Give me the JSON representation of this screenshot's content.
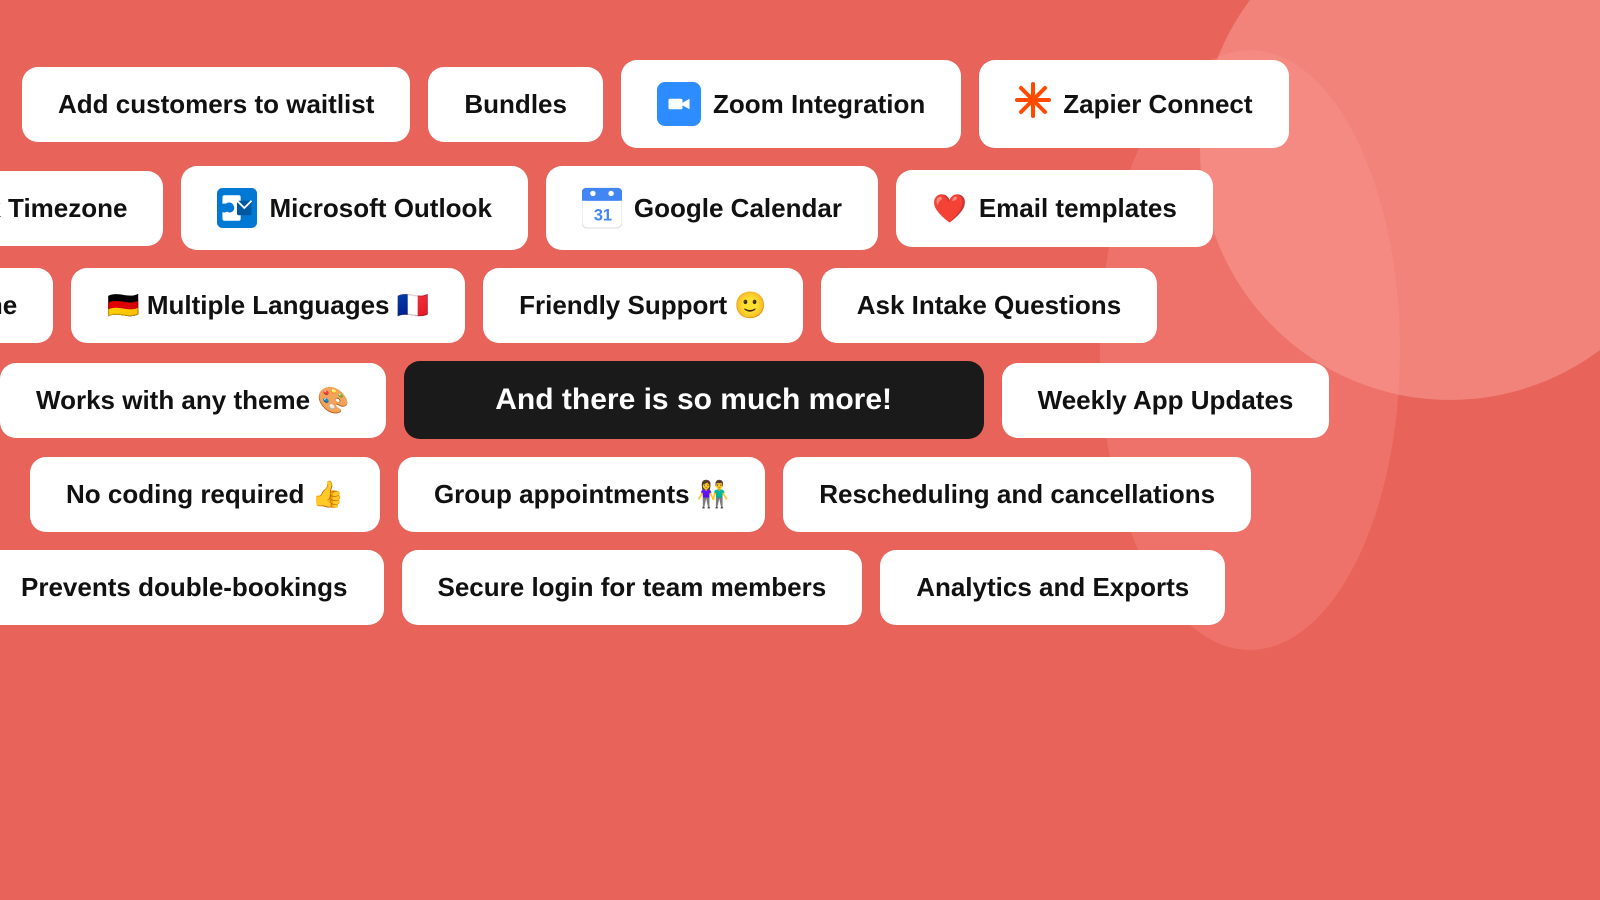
{
  "background": "#e8635a",
  "rows": [
    {
      "id": "row1",
      "items": [
        {
          "id": "add-waitlist",
          "text": "Add customers to waitlist",
          "type": "plain"
        },
        {
          "id": "bundles",
          "text": "Bundles",
          "type": "plain"
        },
        {
          "id": "zoom",
          "text": "Zoom Integration",
          "type": "zoom"
        },
        {
          "id": "zapier",
          "text": "Zapier Connect",
          "type": "zapier"
        }
      ]
    },
    {
      "id": "row2",
      "items": [
        {
          "id": "timezone",
          "text": "ock Timezone",
          "type": "plain"
        },
        {
          "id": "outlook",
          "text": "Microsoft Outlook",
          "type": "outlook"
        },
        {
          "id": "gcal",
          "text": "Google Calendar",
          "type": "gcal"
        },
        {
          "id": "email-templates",
          "text": "Email templates",
          "type": "email"
        }
      ]
    },
    {
      "id": "row3",
      "items": [
        {
          "id": "uptime",
          "text": "o Uptime",
          "type": "plain"
        },
        {
          "id": "languages",
          "text": "🇩🇪 Multiple Languages 🇫🇷",
          "type": "plain"
        },
        {
          "id": "support",
          "text": "Friendly Support 🙂",
          "type": "plain"
        },
        {
          "id": "intake",
          "text": "Ask Intake Questions",
          "type": "plain"
        }
      ]
    },
    {
      "id": "row4",
      "items": [
        {
          "id": "theme",
          "text": "Works with any theme 🎨",
          "type": "plain"
        },
        {
          "id": "more",
          "text": "And there is so much more!",
          "type": "dark"
        },
        {
          "id": "weekly-updates",
          "text": "Weekly App Updates",
          "type": "plain"
        }
      ]
    },
    {
      "id": "row5",
      "items": [
        {
          "id": "no-coding",
          "text": "No coding required 👍",
          "type": "plain"
        },
        {
          "id": "group-appts",
          "text": "Group appointments 👫",
          "type": "plain"
        },
        {
          "id": "rescheduling",
          "text": "Rescheduling and cancellations",
          "type": "plain"
        }
      ]
    },
    {
      "id": "row6",
      "items": [
        {
          "id": "double-bookings",
          "text": "Prevents double-bookings",
          "type": "plain"
        },
        {
          "id": "secure-login",
          "text": "Secure login for team members",
          "type": "plain"
        },
        {
          "id": "analytics",
          "text": "Analytics and Exports",
          "type": "plain"
        }
      ]
    }
  ]
}
